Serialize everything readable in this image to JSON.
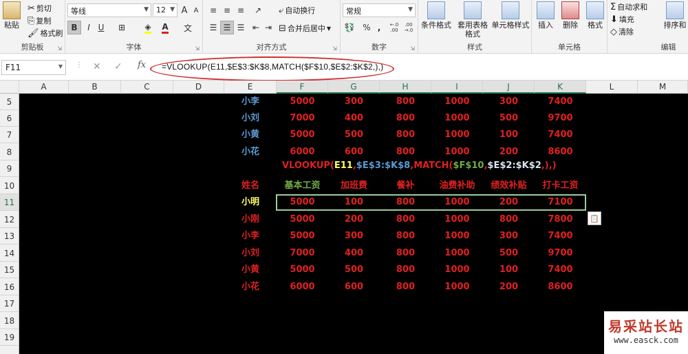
{
  "ribbon": {
    "clipboard": {
      "paste": "粘贴",
      "cut": "剪切",
      "copy": "复制",
      "format_painter": "格式刷",
      "label": "剪贴板"
    },
    "font": {
      "name": "等线",
      "size": "12",
      "grow": "A",
      "shrink": "A",
      "bold": "B",
      "italic": "I",
      "underline": "U",
      "phonetic": "文",
      "label": "字体"
    },
    "alignment": {
      "wrap": "自动换行",
      "merge": "合并后居中",
      "label": "对齐方式"
    },
    "number": {
      "format": "常规",
      "percent": "%",
      "comma": ",",
      "inc_dec": "←.0 .00",
      "dec_dec": ".00 →.0",
      "label": "数字"
    },
    "styles": {
      "conditional": "条件格式",
      "table": "套用表格格式",
      "cell_styles": "单元格样式",
      "label": "样式"
    },
    "cells": {
      "insert": "插入",
      "delete": "删除",
      "format": "格式",
      "label": "单元格"
    },
    "editing": {
      "autosum": "自动求和",
      "fill": "填充",
      "clear": "清除",
      "sort": "排序和",
      "label": "编辑"
    }
  },
  "formula_bar": {
    "name_box": "F11",
    "fx": "fx",
    "formula": "=VLOOKUP(E11,$E$3:$K$8,MATCH($F$10,$E$2:$K$2,),)"
  },
  "columns": [
    "A",
    "B",
    "C",
    "D",
    "E",
    "F",
    "G",
    "H",
    "I",
    "J",
    "K",
    "L",
    "M"
  ],
  "rows": [
    "5",
    "6",
    "7",
    "8",
    "9",
    "10",
    "11",
    "12",
    "13",
    "14",
    "15",
    "16",
    "17",
    "18",
    "19"
  ],
  "top_table": [
    [
      "小李",
      "5000",
      "300",
      "800",
      "1000",
      "300",
      "7400"
    ],
    [
      "小刘",
      "7000",
      "400",
      "800",
      "1000",
      "500",
      "9700"
    ],
    [
      "小黄",
      "5000",
      "500",
      "800",
      "1000",
      "100",
      "7400"
    ],
    [
      "小花",
      "6000",
      "600",
      "800",
      "1000",
      "200",
      "8600"
    ]
  ],
  "formula_display": {
    "p1": "VLOOKUP(",
    "p2": "E11",
    "p3": ",",
    "p4": "$E$3:$K$8",
    "p5": ",",
    "p6": "MATCH(",
    "p7": "$F$10",
    "p8": ",",
    "p9": "$E$2:$K$2",
    "p10": ",),)"
  },
  "headers": [
    "姓名",
    "基本工资",
    "加班费",
    "餐补",
    "油费补助",
    "绩效补贴",
    "打卡工资"
  ],
  "result_row": [
    "小明",
    "5000",
    "100",
    "800",
    "1000",
    "200",
    "7100"
  ],
  "bottom_table": [
    [
      "小刚",
      "5000",
      "200",
      "800",
      "1000",
      "800",
      "7800"
    ],
    [
      "小李",
      "5000",
      "300",
      "800",
      "1000",
      "300",
      "7400"
    ],
    [
      "小刘",
      "7000",
      "400",
      "800",
      "1000",
      "500",
      "9700"
    ],
    [
      "小黄",
      "5000",
      "500",
      "800",
      "1000",
      "100",
      "7400"
    ],
    [
      "小花",
      "6000",
      "600",
      "800",
      "1000",
      "200",
      "8600"
    ]
  ],
  "watermark": {
    "title": "易采站长站",
    "url": "www.easck.com"
  }
}
